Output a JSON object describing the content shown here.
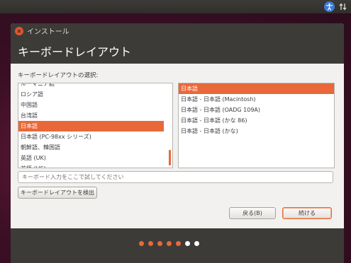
{
  "window": {
    "title": "インストール",
    "page_title": "キーボードレイアウト"
  },
  "layout_list": {
    "label": "キーボードレイアウトの選択:",
    "items": [
      "ルーマニア語",
      "ロシア語",
      "中国語",
      "台湾語",
      "日本語",
      "日本語 (PC-98xx シリーズ)",
      "朝鮮語、韓国語",
      "英語 (UK)",
      "英語 (US)"
    ],
    "selected_index": 4
  },
  "variant_list": {
    "items": [
      "日本語",
      "日本語 - 日本語 (Macintosh)",
      "日本語 - 日本語 (OADG 109A)",
      "日本語 - 日本語 (かな 86)",
      "日本語 - 日本語 (かな)"
    ],
    "selected_index": 0
  },
  "test_input": {
    "placeholder": "キーボード入力をここで試してください",
    "value": ""
  },
  "buttons": {
    "detect": "キーボードレイアウトを検出",
    "back": "戻る(B)",
    "next": "続ける"
  },
  "progress": {
    "total_steps": 7,
    "completed_steps": 5
  },
  "colors": {
    "accent": "#e8683a",
    "header": "#3c3b37",
    "window_bg": "#f2f1f0",
    "dot_done": "#e8683a",
    "dot_pending": "#ffffff"
  },
  "icons": {
    "panel": [
      "accessibility-icon",
      "network-icon"
    ],
    "close": "close-icon"
  }
}
